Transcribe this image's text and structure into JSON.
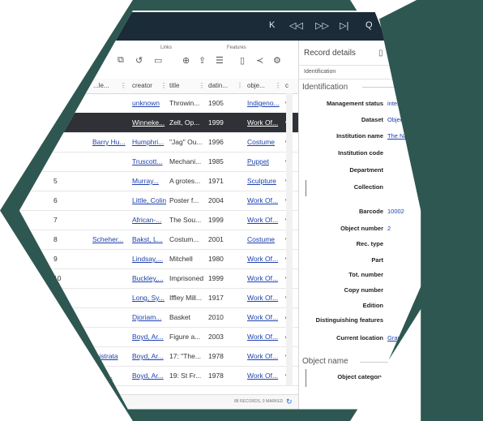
{
  "nav": {
    "first": "K",
    "prev": "◁◁",
    "next": "▷▷",
    "last": "▷|",
    "search": "Q"
  },
  "toolbar": {
    "links_label": "Links",
    "features_label": "Features"
  },
  "grid": {
    "headers": [
      "...le...",
      "creator",
      "title",
      "datin...",
      "obje...",
      "c"
    ],
    "rows": [
      {
        "num": "",
        "ref": "",
        "creator": "unknown",
        "title": "Throwin...",
        "date": "1905",
        "object": "Indigeno...",
        "extra": "v"
      },
      {
        "num": "",
        "ref": "",
        "creator": "Winneke...",
        "title": "Zelt, Op...",
        "date": "1999",
        "object": "Work Of...",
        "extra": "v"
      },
      {
        "num": "",
        "ref": "Barry Hu...",
        "creator": "Humphri...",
        "title": "\"Jag\" Ou...",
        "date": "1996",
        "object": "Costume",
        "extra": "v"
      },
      {
        "num": "",
        "ref": "",
        "creator": "Truscott...",
        "title": "Mechani...",
        "date": "1985",
        "object": "Puppet",
        "extra": "v"
      },
      {
        "num": "5",
        "ref": "",
        "creator": "Murray...",
        "title": "A grotes...",
        "date": "1971",
        "object": "Sculpture",
        "extra": "v"
      },
      {
        "num": "6",
        "ref": "",
        "creator": "Little, Colin",
        "title": "Poster f...",
        "date": "2004",
        "object": "Work Of...",
        "extra": "v"
      },
      {
        "num": "7",
        "ref": "",
        "creator": "African-...",
        "title": "The Sou...",
        "date": "1999",
        "object": "Work Of...",
        "extra": "v"
      },
      {
        "num": "8",
        "ref": "Scheher...",
        "creator": "Bakst, L...",
        "title": "Costum...",
        "date": "2001",
        "object": "Costume",
        "extra": "v"
      },
      {
        "num": "9",
        "ref": "",
        "creator": "Lindsay,...",
        "title": "Mitchell",
        "date": "1980",
        "object": "Work Of...",
        "extra": "v"
      },
      {
        "num": "10",
        "ref": "",
        "creator": "Buckley,...",
        "title": "Imprisoned",
        "date": "1999",
        "object": "Work Of...",
        "extra": "v"
      },
      {
        "num": "",
        "ref": "",
        "creator": "Long, Sy...",
        "title": "Iffley Mill...",
        "date": "1917",
        "object": "Work Of...",
        "extra": "v"
      },
      {
        "num": "",
        "ref": "",
        "creator": "Djoriam...",
        "title": "Basket",
        "date": "2010",
        "object": "Work Of...",
        "extra": "c"
      },
      {
        "num": "",
        "ref": "",
        "creator": "Boyd, Ar...",
        "title": "Figure a...",
        "date": "2003",
        "object": "Work Of...",
        "extra": "c"
      },
      {
        "num": "",
        "ref": "ysistrata",
        "creator": "Boyd, Ar...",
        "title": "17: \"The...",
        "date": "1978",
        "object": "Work Of...",
        "extra": "v"
      },
      {
        "num": "",
        "ref": "of St...",
        "creator": "Boyd, Ar...",
        "title": "19: St Fr...",
        "date": "1978",
        "object": "Work Of...",
        "extra": "v"
      }
    ],
    "status": "88 RECORDS, 0 MARKED"
  },
  "panel": {
    "title": "Record details",
    "tab": "Identification",
    "groups": {
      "identification": "Identification",
      "object_name": "Object name"
    },
    "fields": [
      {
        "label": "Management status",
        "value": "internal"
      },
      {
        "label": "Dataset",
        "value": "Object catalog"
      },
      {
        "label": "Institution name",
        "value": "The National Mu"
      },
      {
        "label": "Institution code",
        "value": ""
      },
      {
        "label": "Department",
        "value": ""
      },
      {
        "label": "Collection",
        "value": ""
      },
      {
        "label": "Barcode",
        "value": "10002"
      },
      {
        "label": "Object number",
        "value": "2"
      },
      {
        "label": "Rec. type",
        "value": ""
      },
      {
        "label": "Part",
        "value": ""
      },
      {
        "label": "Tot. number",
        "value": ""
      },
      {
        "label": "Copy number",
        "value": ""
      },
      {
        "label": "Edition",
        "value": ""
      },
      {
        "label": "Distinguishing features",
        "value": ""
      },
      {
        "label": "Current location",
        "value": "Grand h"
      },
      {
        "label": "Object category",
        "value": ""
      }
    ]
  },
  "colors": {
    "frame": "#2e5751",
    "topbar": "#1b2b37",
    "selected_row": "#2f3136",
    "link": "#1f42ad"
  }
}
